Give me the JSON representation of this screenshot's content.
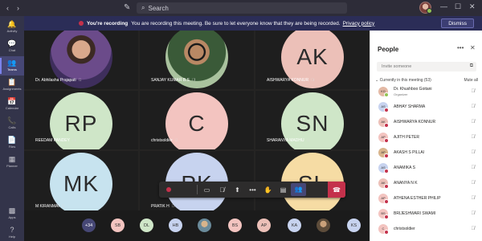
{
  "titlebar": {
    "search_placeholder": "Search",
    "search_icon": "search-icon",
    "compose_icon": "compose-icon"
  },
  "rail": [
    {
      "label": "Activity",
      "icon": "🔔"
    },
    {
      "label": "Chat",
      "icon": "💬"
    },
    {
      "label": "Teams",
      "icon": "👥",
      "active": true
    },
    {
      "label": "Assignments",
      "icon": "📋"
    },
    {
      "label": "Calendar",
      "icon": "📅"
    },
    {
      "label": "Calls",
      "icon": "📞"
    },
    {
      "label": "Files",
      "icon": "📄"
    },
    {
      "label": "Planner",
      "icon": "▦"
    },
    {
      "label": "Apps",
      "icon": "▩"
    },
    {
      "label": "Help",
      "icon": "?"
    }
  ],
  "banner": {
    "title": "You're recording",
    "message": "You are recording this meeting. Be sure to let everyone know that they are being recorded.",
    "link": "Privacy policy",
    "dismiss": "Dismiss"
  },
  "tiles": [
    {
      "name": "Dr. Abhilasha Prajapati",
      "initials": "",
      "photo": "photo-pp"
    },
    {
      "name": "SANJAY KUMAR B.S",
      "initials": "",
      "photo": "photo-sk"
    },
    {
      "name": "AISHWARYA KONNUR",
      "initials": "AK",
      "color": "#ecc0b8"
    },
    {
      "name": "REEDAM PANDEY",
      "initials": "RP",
      "color": "#cfe6c8"
    },
    {
      "name": "christsoldier",
      "initials": "C",
      "color": "#f3c4c0"
    },
    {
      "name": "SHARANYA MADHU",
      "initials": "SN",
      "color": "#cfe6c8"
    },
    {
      "name": "M KIRANMAI",
      "initials": "MK",
      "color": "#c7e3ef"
    },
    {
      "name": "PRATIK H",
      "initials": "PK",
      "color": "#c7d3ef"
    },
    {
      "name": "",
      "initials": "SL",
      "color": "#f6dca4"
    }
  ],
  "controls": {
    "timer": "",
    "icons": [
      "camera-icon",
      "mic-off-icon",
      "share-icon",
      "more-icon",
      "raise-hand-icon",
      "chat-icon",
      "participants-icon"
    ]
  },
  "strip": [
    {
      "label": "+34",
      "color": "#464775"
    },
    {
      "label": "SB",
      "color": "#f3c4c0"
    },
    {
      "label": "DL",
      "color": "#cfe6c8"
    },
    {
      "label": "HB",
      "color": "#c7d3ef"
    },
    {
      "label": "",
      "color": "img"
    },
    {
      "label": "BS",
      "color": "#f3c4c0"
    },
    {
      "label": "AP",
      "color": "#ecc0b8"
    },
    {
      "label": "KA",
      "color": "#c7d3ef"
    },
    {
      "label": "",
      "color": "img2"
    },
    {
      "label": "KS",
      "color": "#c7d3ef"
    }
  ],
  "people": {
    "title": "People",
    "invite_placeholder": "Invite someone",
    "section": "Currently in this meeting (53)",
    "mute_all": "Mute all",
    "list": [
      {
        "name": "Dr. Khushboo Goitani",
        "role": "Organizer",
        "initials": "KG",
        "color": "#e3b9a5",
        "ok": true
      },
      {
        "name": "ABHAY SHARMA",
        "initials": "AS",
        "color": "#c7d3ef"
      },
      {
        "name": "AISHWARYA KONNUR",
        "initials": "AK",
        "color": "#ecc0b8"
      },
      {
        "name": "AJITH PETER",
        "initials": "AP",
        "color": "#f3c4c0"
      },
      {
        "name": "AKASH S PILLAI",
        "initials": "AP",
        "color": "#d8b48c"
      },
      {
        "name": "ANAMIKA S",
        "initials": "AS",
        "color": "#c7d3ef"
      },
      {
        "name": "ANANYA N K",
        "initials": "AK",
        "color": "#ecc0b8"
      },
      {
        "name": "ATHENA ESTHER PHILIP",
        "initials": "AP",
        "color": "#f3c4c0"
      },
      {
        "name": "BRIJESHWARI SWAMI",
        "initials": "BS",
        "color": "#f3c4c0"
      },
      {
        "name": "christsoldier",
        "initials": "C",
        "color": "#f3c4c0"
      }
    ]
  }
}
